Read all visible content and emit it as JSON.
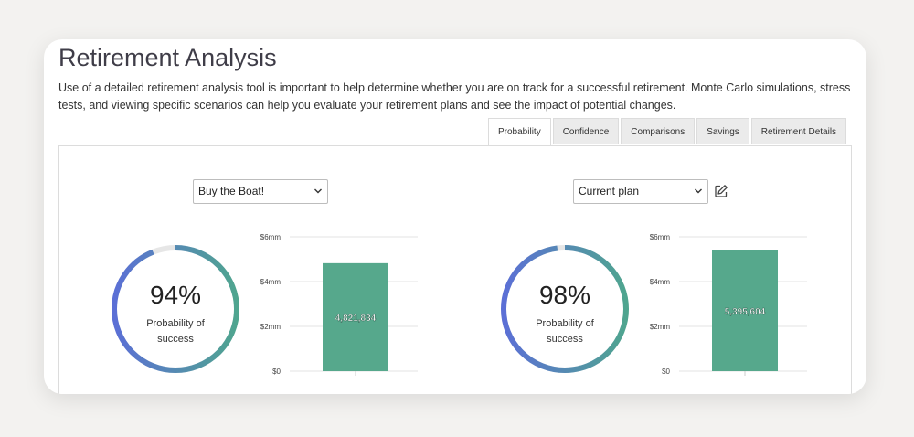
{
  "page": {
    "title": "Retirement Analysis",
    "description": "Use of a detailed retirement analysis tool is important to help determine whether you are on track for a successful retirement. Monte Carlo simulations, stress tests, and viewing specific scenarios can help you evaluate your retirement plans and see the impact of potential changes."
  },
  "tabs": [
    "Probability",
    "Confidence",
    "Comparisons",
    "Savings",
    "Retirement Details"
  ],
  "active_tab": "Probability",
  "left": {
    "select_value": "Buy the Boat!",
    "percent": "94%",
    "percent_value": 0.94,
    "label_line1": "Probability of",
    "label_line2": "success"
  },
  "right": {
    "select_value": "Current plan",
    "percent": "98%",
    "percent_value": 0.98,
    "label_line1": "Probability of",
    "label_line2": "success"
  },
  "colors": {
    "ring_start": "#5b6fd6",
    "ring_end": "#4fa58f",
    "ring_track": "#e6e6e6",
    "bar": "#56a88c"
  },
  "chart_data": [
    {
      "type": "bar",
      "categories": [
        ""
      ],
      "values": [
        4821834
      ],
      "data_labels": [
        "4,821,834"
      ],
      "yticks": [
        0,
        2000000,
        4000000,
        6000000
      ],
      "ytick_labels": [
        "$0",
        "$2mm",
        "$4mm",
        "$6mm"
      ],
      "ylim": [
        0,
        6000000
      ],
      "title": "",
      "xlabel": "",
      "ylabel": "",
      "grid": true
    },
    {
      "type": "bar",
      "categories": [
        ""
      ],
      "values": [
        5395604
      ],
      "data_labels": [
        "5,395,604"
      ],
      "yticks": [
        0,
        2000000,
        4000000,
        6000000
      ],
      "ytick_labels": [
        "$0",
        "$2mm",
        "$4mm",
        "$6mm"
      ],
      "ylim": [
        0,
        6000000
      ],
      "title": "",
      "xlabel": "",
      "ylabel": "",
      "grid": true
    }
  ]
}
